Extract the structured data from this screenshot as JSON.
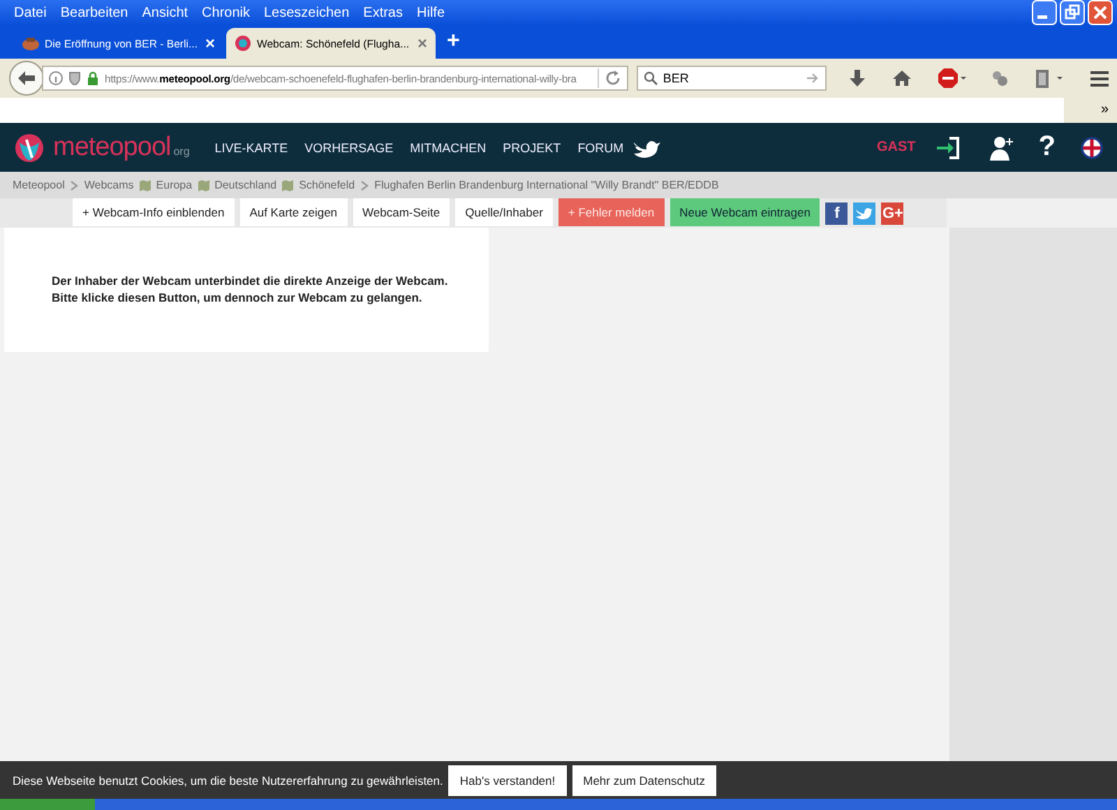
{
  "browser": {
    "menu": [
      "Datei",
      "Bearbeiten",
      "Ansicht",
      "Chronik",
      "Leseszeichen",
      "Extras",
      "Hilfe"
    ],
    "tabs": [
      {
        "title": "Die Eröffnung von BER - Berli...",
        "close": "×",
        "selected": false
      },
      {
        "title": "Webcam: Schönefeld (Flugha...",
        "close": "×",
        "selected": true
      }
    ],
    "new_tab": "+",
    "url": "https://www.**meteopool.org**/de/webcam-schoenefeld-flughafen-berlin-brandenburg-international-willy-bra",
    "search": {
      "value": "BER"
    },
    "bookmarks_overflow": "»"
  },
  "site": {
    "logo": {
      "name": "meteopool",
      "suffix": "org"
    },
    "nav": [
      "LIVE-KARTE",
      "VORHERSAGE",
      "MITMACHEN",
      "PROJEKT",
      "FORUM"
    ],
    "user": "GAST",
    "help": "?"
  },
  "breadcrumb": [
    {
      "label": "Meteopool",
      "kind": "first"
    },
    {
      "label": "Webcams",
      "kind": "chevron"
    },
    {
      "label": "Europa",
      "kind": "map"
    },
    {
      "label": "Deutschland",
      "kind": "map"
    },
    {
      "label": "Schönefeld",
      "kind": "map"
    },
    {
      "label": "Flughafen Berlin Brandenburg International \"Willy Brandt\" BER/EDDB",
      "kind": "chevron"
    }
  ],
  "actions": [
    {
      "label": "+ Webcam-Info einblenden",
      "kind": "plain"
    },
    {
      "label": "Auf Karte zeigen",
      "kind": "plain"
    },
    {
      "label": "Webcam-Seite",
      "kind": "plain"
    },
    {
      "label": "Quelle/Inhaber",
      "kind": "plain"
    },
    {
      "label": "+ Fehler melden",
      "kind": "danger"
    },
    {
      "label": "Neue Webcam eintragen",
      "kind": "success"
    }
  ],
  "social": [
    {
      "kind": "facebook",
      "text": "f"
    },
    {
      "kind": "twitter"
    },
    {
      "kind": "google",
      "text": "G+"
    }
  ],
  "notice": [
    "Der Inhaber der Webcam unterbindet die direkte Anzeige der Webcam.",
    "Bitte klicke diesen Button, um dennoch zur Webcam zu gelangen."
  ],
  "cookie": {
    "text": "Diese Webseite benutzt Cookies, um die beste Nutzererfahrung zu gewährleisten.",
    "buttons": [
      "Hab's verstanden!",
      "Mehr zum Datenschutz"
    ]
  }
}
